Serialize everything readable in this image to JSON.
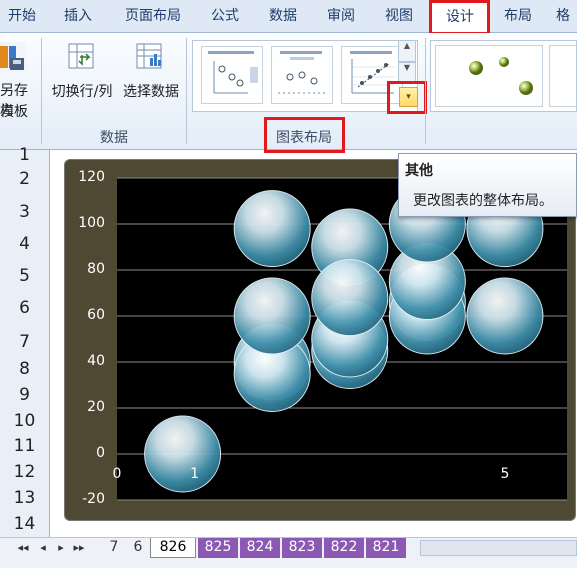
{
  "ribbon_tabs": [
    {
      "label": "开始"
    },
    {
      "label": "插入"
    },
    {
      "label": "页面布局"
    },
    {
      "label": "公式"
    },
    {
      "label": "数据"
    },
    {
      "label": "审阅"
    },
    {
      "label": "视图"
    },
    {
      "label": "设计",
      "active": true
    },
    {
      "label": "布局"
    },
    {
      "label": "格"
    }
  ],
  "ribbon": {
    "save_template_label_1": "另存为",
    "save_template_label_2": "模板",
    "switch_row_col_label": "切换行/列",
    "select_data_label": "选择数据",
    "data_group_label": "数据",
    "chart_layout_group_label": "图表布局",
    "more_button_glyph": "▾"
  },
  "tooltip": {
    "title": "其他",
    "description": "更改图表的整体布局。"
  },
  "rows": [
    "1",
    "2",
    "3",
    "4",
    "5",
    "6",
    "7",
    "8",
    "9",
    "10",
    "11",
    "12",
    "13",
    "14"
  ],
  "chart_data": {
    "type": "bubble",
    "ylim": [
      -20,
      120
    ],
    "yticks": [
      "120",
      "100",
      "80",
      "60",
      "40",
      "20",
      "0",
      "-20"
    ],
    "xtick_visible": [
      "0",
      "1",
      "5"
    ],
    "series": [
      {
        "points": [
          {
            "x": 1,
            "y": 0
          },
          {
            "x": 2,
            "y": 40
          },
          {
            "x": 2,
            "y": 35
          },
          {
            "x": 2,
            "y": 60
          },
          {
            "x": 2,
            "y": 98
          },
          {
            "x": 3,
            "y": 45
          },
          {
            "x": 3,
            "y": 50
          },
          {
            "x": 3,
            "y": 90
          },
          {
            "x": 3,
            "y": 68
          },
          {
            "x": 4,
            "y": 66
          },
          {
            "x": 4,
            "y": 60
          },
          {
            "x": 4,
            "y": 75
          },
          {
            "x": 4,
            "y": 100
          },
          {
            "x": 5,
            "y": 60
          },
          {
            "x": 5,
            "y": 98
          }
        ]
      }
    ],
    "colors": {
      "bubble_dark": "#3f8faa",
      "bubble_light": "#cfe6ef",
      "plot_bg": "#000000",
      "frame": "#4f4832"
    }
  },
  "sheet_tabs": [
    {
      "label": "7"
    },
    {
      "label": "6"
    },
    {
      "label": "826",
      "active": true
    },
    {
      "label": "825"
    },
    {
      "label": "824"
    },
    {
      "label": "823"
    },
    {
      "label": "822"
    },
    {
      "label": "821"
    }
  ]
}
